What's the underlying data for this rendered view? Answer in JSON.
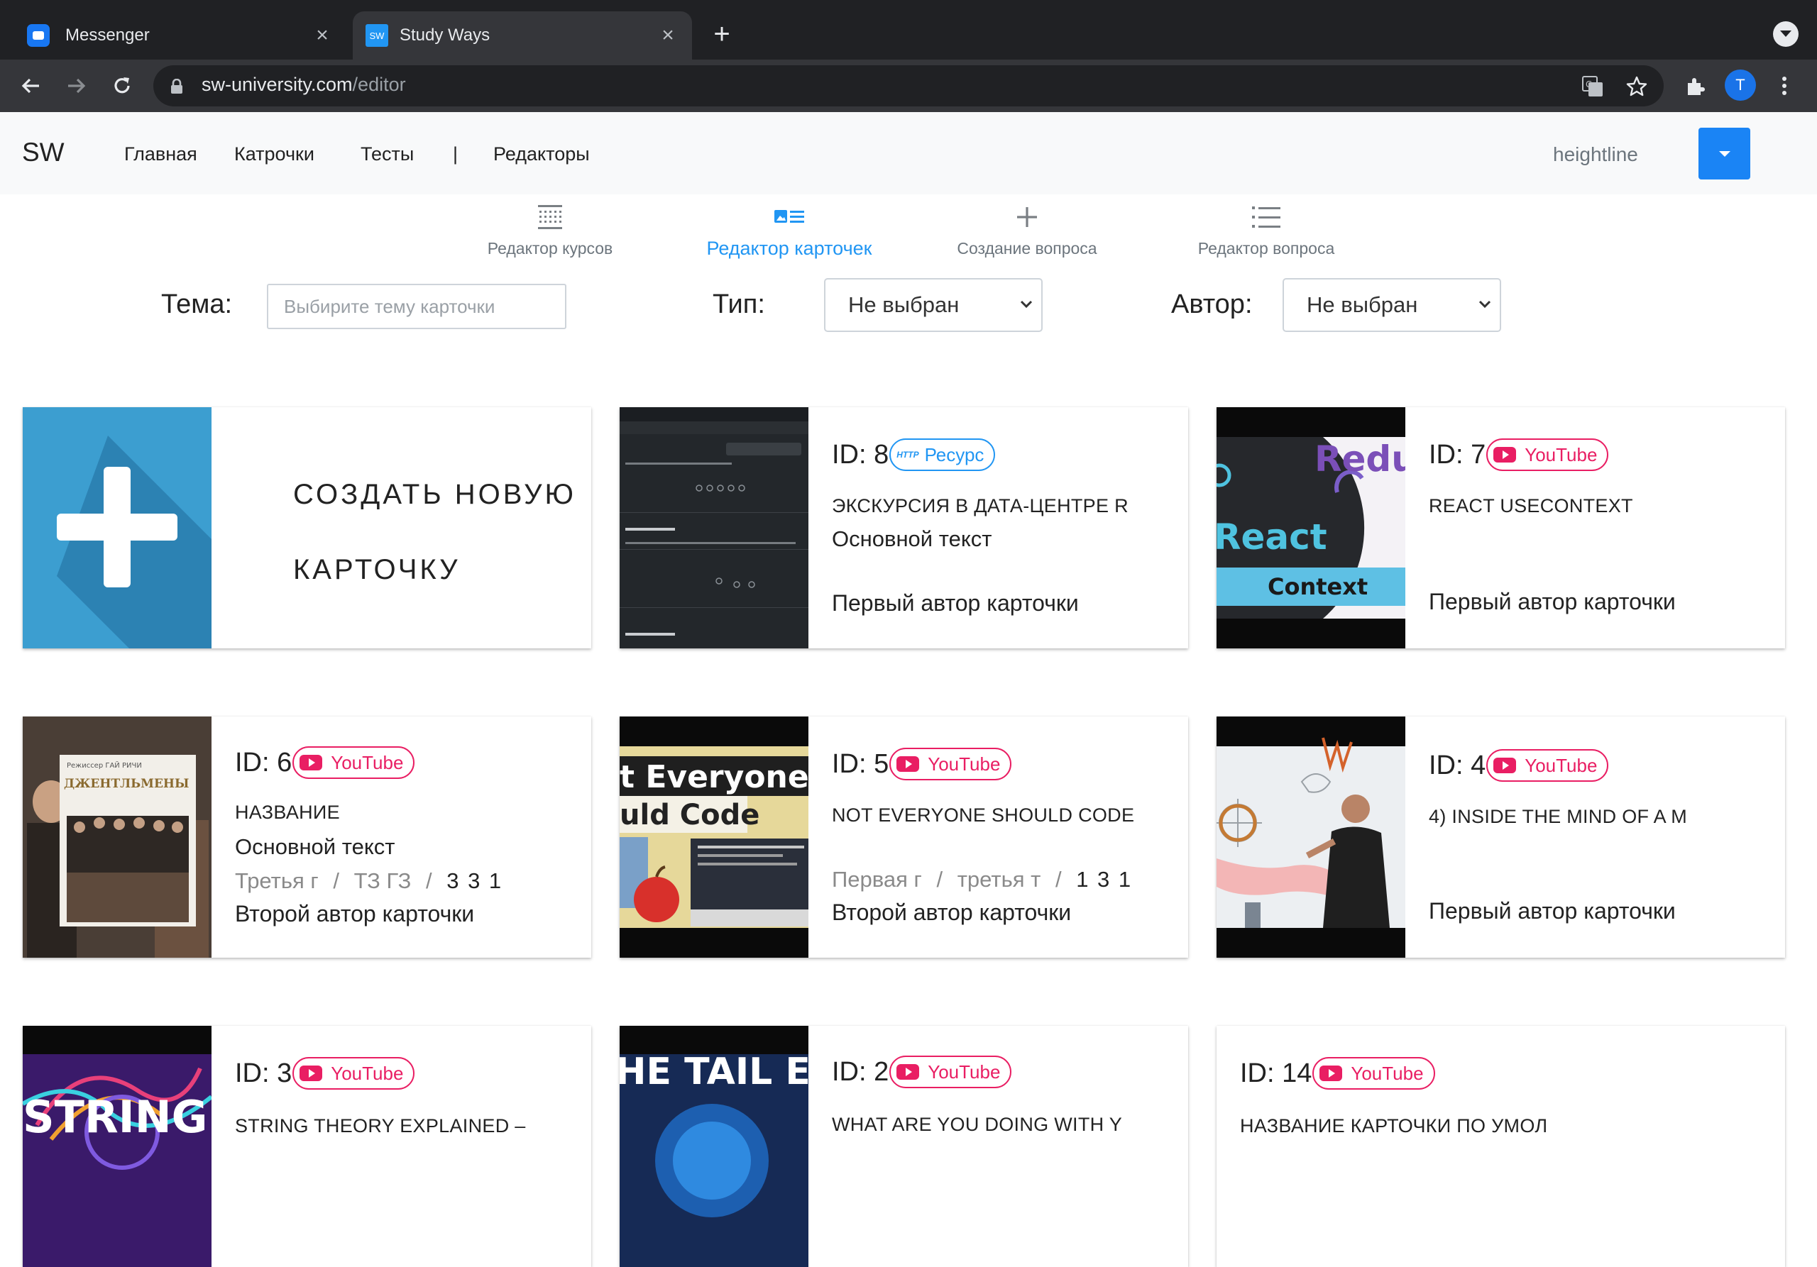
{
  "browser": {
    "tabs": [
      {
        "title": "Messenger",
        "favicon": "messenger-icon"
      },
      {
        "title": "Study Ways",
        "favicon": "sw-icon",
        "favicon_text": "SW"
      }
    ],
    "url_host": "sw-university.com",
    "url_path": "/editor",
    "profile_initial": "T"
  },
  "navbar": {
    "brand": "SW",
    "links": [
      "Главная",
      "Катрочки",
      "Тесты",
      "|",
      "Редакторы"
    ],
    "user": "heightline"
  },
  "editor_tabs": [
    {
      "label": "Редактор курсов",
      "icon": "grid-icon",
      "active": false
    },
    {
      "label": "Редактор карточек",
      "icon": "card-icon",
      "active": true
    },
    {
      "label": "Создание вопроса",
      "icon": "plus-icon",
      "active": false
    },
    {
      "label": "Редактор вопроса",
      "icon": "list-icon",
      "active": false
    }
  ],
  "filters": {
    "topic_label": "Тема:",
    "topic_placeholder": "Выбирите тему карточки",
    "type_label": "Тип:",
    "type_value": "Не выбран",
    "author_label": "Автор:",
    "author_value": "Не выбран"
  },
  "create_card": {
    "line1": "СОЗДАТЬ НОВУЮ",
    "line2": "КАРТОЧКУ"
  },
  "cards": [
    {
      "id": "ID: 8",
      "badge": "Ресурс",
      "badge_prefix": "HTTP",
      "title": "ЭКСКУРСИЯ В ДАТА-ЦЕНТРЕ R",
      "text": "Основной текст",
      "author": "Первый автор карточки"
    },
    {
      "id": "ID: 7",
      "badge": "YouTube",
      "title": "REACT USECONTEXT",
      "author": "Первый автор карточки",
      "thumb_words": [
        "Redu",
        "React",
        "Context"
      ]
    },
    {
      "id": "ID: 6",
      "badge": "YouTube",
      "title": "НАЗВАНИЕ",
      "text": "Основной текст",
      "meta_a": "Третья г",
      "meta_sep": "/",
      "meta_b": "ТЗ ГЗ",
      "meta_nums": "3 3 1",
      "author": "Второй автор карточки",
      "thumb_words": [
        "ДЖЕНТЛЬМЕНЫ"
      ]
    },
    {
      "id": "ID: 5",
      "badge": "YouTube",
      "title": "NOT EVERYONE SHOULD CODE",
      "meta_a": "Первая г",
      "meta_sep": "/",
      "meta_b": "третья т",
      "meta_nums": "1 3 1",
      "author": "Второй автор карточки",
      "thumb_words": [
        "t Everyone",
        "uld Code"
      ]
    },
    {
      "id": "ID: 4",
      "badge": "YouTube",
      "title": "4) INSIDE THE MIND OF A M",
      "author": "Первый автор карточки"
    },
    {
      "id": "ID: 3",
      "badge": "YouTube",
      "title": "STRING THEORY EXPLAINED –",
      "thumb_words": [
        "STRING"
      ]
    },
    {
      "id": "ID: 2",
      "badge": "YouTube",
      "title": "WHAT ARE YOU DOING WITH Y",
      "thumb_words": [
        "HE TAIL EN"
      ]
    },
    {
      "id": "ID: 14",
      "badge": "YouTube",
      "title": "НАЗВАНИЕ КАРТОЧКИ ПО УМОЛ"
    }
  ]
}
